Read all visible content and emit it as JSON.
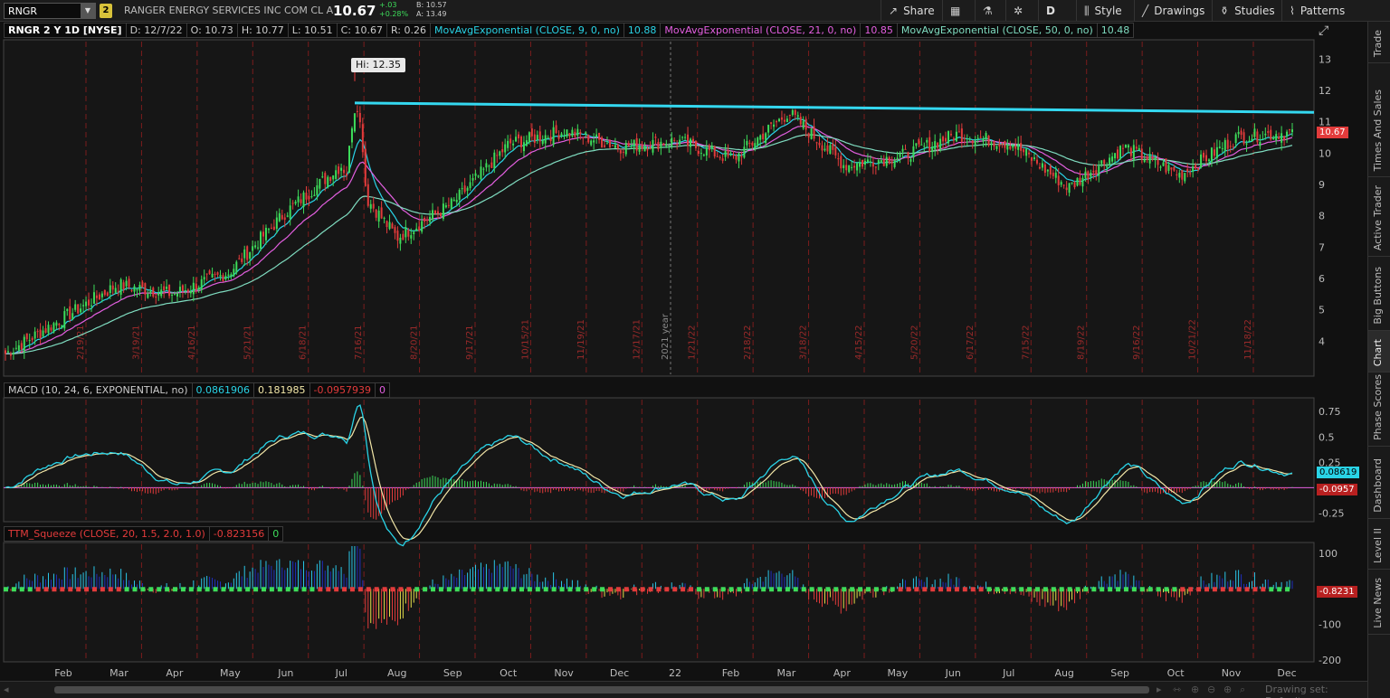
{
  "toolbar": {
    "symbol": "RNGR",
    "link_number": "2",
    "company": "RANGER ENERGY SERVICES INC COM CL A",
    "last": "10.67",
    "change": "+.03",
    "change_pct": "+0.28%",
    "bid": "B: 10.57",
    "ask": "A: 13.49",
    "buttons": {
      "share": "Share",
      "period": "D",
      "style": "Style",
      "drawings": "Drawings",
      "studies": "Studies",
      "patterns": "Patterns"
    }
  },
  "header": {
    "title": "RNGR 2 Y 1D [NYSE]",
    "date": "D: 12/7/22",
    "open": "O: 10.73",
    "high": "H: 10.77",
    "low": "L: 10.51",
    "close": "C: 10.67",
    "range": "R: 0.26",
    "ema9_label": "MovAvgExponential (CLOSE, 9, 0, no)",
    "ema9_value": "10.88",
    "ema21_label": "MovAvgExponential (CLOSE, 21, 0, no)",
    "ema21_value": "10.85",
    "ema50_label": "MovAvgExponential (CLOSE, 50, 0, no)",
    "ema50_value": "10.48"
  },
  "price_axis": [
    "13",
    "12",
    "11",
    "10",
    "9",
    "8",
    "7",
    "6",
    "5",
    "4"
  ],
  "price_tag": "10.67",
  "hi_marker": "Hi: 12.35",
  "year_marker": "2021 year",
  "event_dates": [
    "2/19/21",
    "3/19/21",
    "4/16/21",
    "5/21/21",
    "6/18/21",
    "7/16/21",
    "8/20/21",
    "9/17/21",
    "10/15/21",
    "11/19/21",
    "12/17/21",
    "1/21/22",
    "2/18/22",
    "3/18/22",
    "4/15/22",
    "5/20/22",
    "6/17/22",
    "7/15/22",
    "8/19/22",
    "9/16/22",
    "10/21/22",
    "11/18/22"
  ],
  "macd": {
    "label": "MACD (10, 24, 6, EXPONENTIAL, no)",
    "value": "0.0861906",
    "avg": "0.181985",
    "diff": "-0.0957939",
    "zero": "0",
    "axis": [
      "0.75",
      "0.5",
      "0.25",
      "-0.25"
    ],
    "tag_value": "0.08619",
    "tag_diff": "-0.0957"
  },
  "ttm": {
    "label": "TTM_Squeeze (CLOSE, 20, 1.5, 2.0, 1.0)",
    "value": "-0.823156",
    "zero": "0",
    "axis": [
      "100",
      "-100",
      "-200"
    ],
    "tag_value": "-0.8231"
  },
  "time_axis": [
    "Feb",
    "Mar",
    "Apr",
    "May",
    "Jun",
    "Jul",
    "Aug",
    "Sep",
    "Oct",
    "Nov",
    "Dec",
    "22",
    "Feb",
    "Mar",
    "Apr",
    "May",
    "Jun",
    "Jul",
    "Aug",
    "Sep",
    "Oct",
    "Nov",
    "Dec"
  ],
  "sidetabs": [
    "Trade",
    "Times And Sales",
    "Active Trader",
    "Big Buttons",
    "Chart",
    "Phase Scores",
    "Dashboard",
    "Level II",
    "Live News"
  ],
  "footer": {
    "drawing_set": "Drawing set: Default"
  },
  "colors": {
    "up": "#3ddc5a",
    "down": "#e23b3b",
    "ema9": "#29d3e6",
    "ema21": "#e35fe0",
    "ema50": "#7fdcc0",
    "trendline": "#34d8f0",
    "macd": "#29d3e6",
    "macd_avg": "#f3e7a8",
    "squeeze_pos": "#29c6e8",
    "squeeze_pos_fade": "#1f2fbf",
    "squeeze_neg": "#e23b3b",
    "squeeze_neg_fade": "#e6e04a"
  },
  "chart_data": {
    "type": "candlestick",
    "title": "RNGR 2 Y 1D [NYSE]",
    "x_anchor_months": [
      "Jan-21",
      "Feb-21",
      "Mar-21",
      "Apr-21",
      "May-21",
      "Jun-21",
      "Jul-21",
      "Aug-21",
      "Sep-21",
      "Oct-21",
      "Nov-21",
      "Dec-21",
      "Jan-22",
      "Feb-22",
      "Mar-22",
      "Apr-22",
      "May-22",
      "Jun-22",
      "Jul-22",
      "Aug-22",
      "Sep-22",
      "Oct-22",
      "Nov-22",
      "Dec-22"
    ],
    "close_anchors": [
      3.6,
      4.7,
      5.8,
      5.5,
      6.2,
      8.1,
      9.6,
      7.3,
      8.4,
      10.3,
      10.7,
      10.2,
      10.4,
      9.8,
      11.3,
      9.6,
      9.9,
      10.6,
      10.3,
      8.9,
      10.2,
      9.3,
      10.5,
      10.67
    ],
    "ylim": [
      3,
      13.5
    ],
    "hi": 12.35,
    "trendline": {
      "start": 11.6,
      "end": 11.3
    },
    "macd_range": [
      -0.3,
      0.85
    ],
    "ttm_range": [
      -200,
      120
    ]
  }
}
